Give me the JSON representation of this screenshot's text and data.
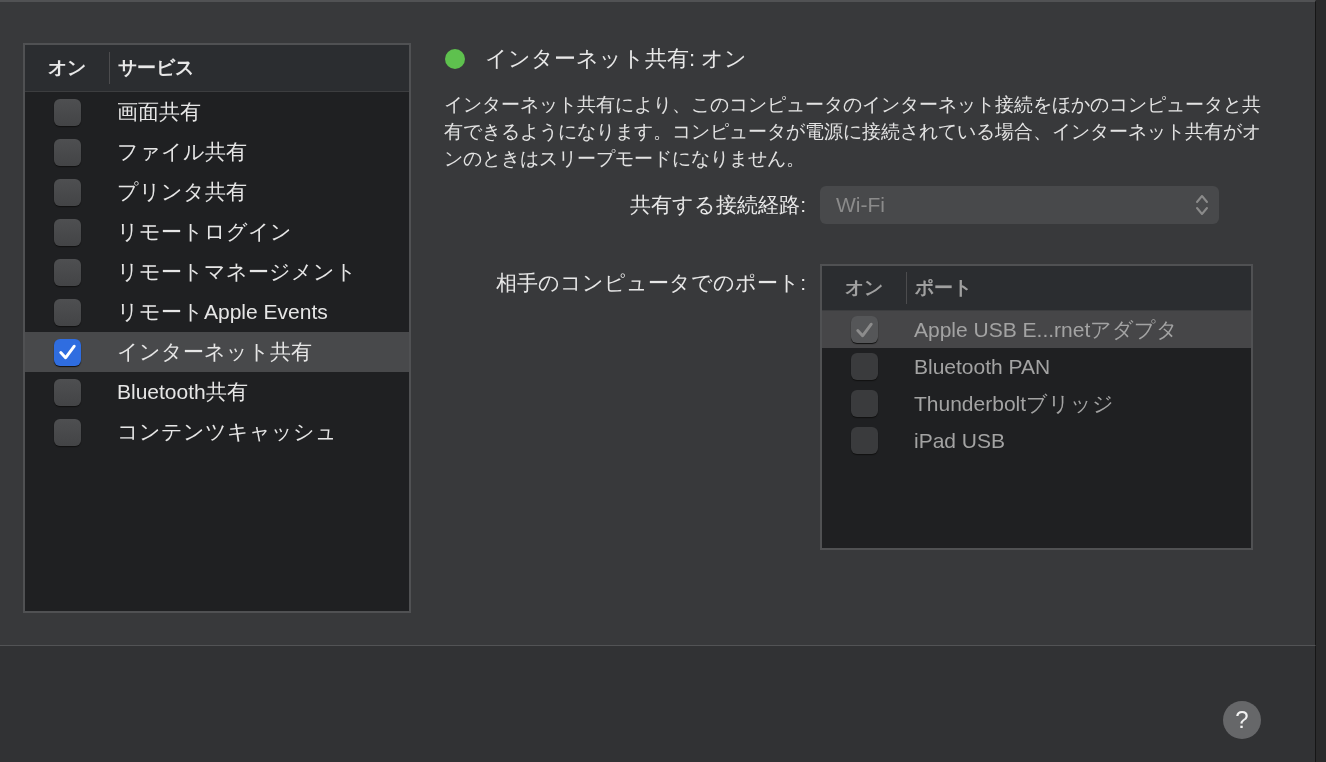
{
  "services": {
    "columns": [
      "オン",
      "サービス"
    ],
    "items": [
      {
        "label": "画面共有",
        "checked": false,
        "selected": false
      },
      {
        "label": "ファイル共有",
        "checked": false,
        "selected": false
      },
      {
        "label": "プリンタ共有",
        "checked": false,
        "selected": false
      },
      {
        "label": "リモートログイン",
        "checked": false,
        "selected": false
      },
      {
        "label": "リモートマネージメント",
        "checked": false,
        "selected": false
      },
      {
        "label": "リモートApple Events",
        "checked": false,
        "selected": false
      },
      {
        "label": "インターネット共有",
        "checked": true,
        "selected": true
      },
      {
        "label": "Bluetooth共有",
        "checked": false,
        "selected": false
      },
      {
        "label": "コンテンツキャッシュ",
        "checked": false,
        "selected": false
      }
    ]
  },
  "status": {
    "on": true,
    "title": "インターネット共有: オン"
  },
  "description": "インターネット共有により、このコンピュータのインターネット接続をほかのコンピュータと共有できるようになります。コンピュータが電源に接続されている場合、インターネット共有がオンのときはスリープモードになりません。",
  "share_from": {
    "label": "共有する接続経路:",
    "value": "Wi-Fi",
    "disabled": true
  },
  "ports": {
    "label": "相手のコンピュータでのポート:",
    "disabled": true,
    "columns": [
      "オン",
      "ポート"
    ],
    "items": [
      {
        "label": "Apple USB E...rnetアダプタ",
        "checked": true,
        "selected": true
      },
      {
        "label": "Bluetooth PAN",
        "checked": false,
        "selected": false
      },
      {
        "label": "Thunderboltブリッジ",
        "checked": false,
        "selected": false
      },
      {
        "label": "iPad USB",
        "checked": false,
        "selected": false
      }
    ]
  },
  "help_button": "?"
}
